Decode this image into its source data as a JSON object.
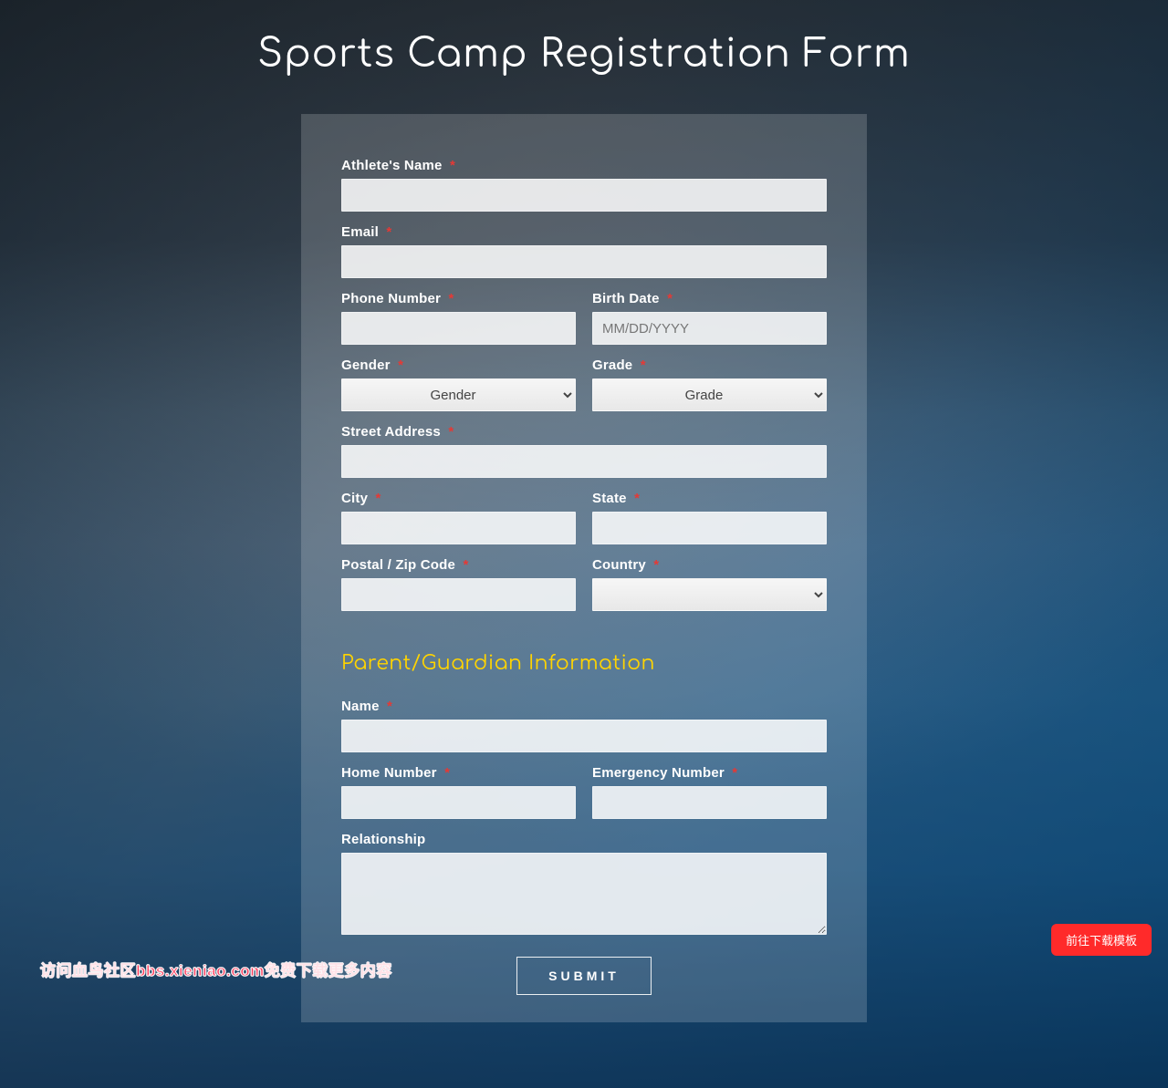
{
  "title": "Sports Camp Registration Form",
  "required_marker": "*",
  "athlete": {
    "name_label": "Athlete's Name",
    "email_label": "Email",
    "phone_label": "Phone Number",
    "birth_label": "Birth Date",
    "birth_placeholder": "MM/DD/YYYY",
    "gender_label": "Gender",
    "gender_selected": "Gender",
    "grade_label": "Grade",
    "grade_selected": "Grade",
    "street_label": "Street Address",
    "city_label": "City",
    "state_label": "State",
    "postal_label": "Postal / Zip Code",
    "country_label": "Country",
    "country_selected": ""
  },
  "guardian": {
    "section_title": "Parent/Guardian Information",
    "name_label": "Name",
    "home_label": "Home Number",
    "emergency_label": "Emergency Number",
    "relationship_label": "Relationship"
  },
  "submit_label": "SUBMIT",
  "float_button_label": "前往下载模板",
  "watermark_text": "访问血鸟社区bbs.xieniao.com免费下载更多内容"
}
